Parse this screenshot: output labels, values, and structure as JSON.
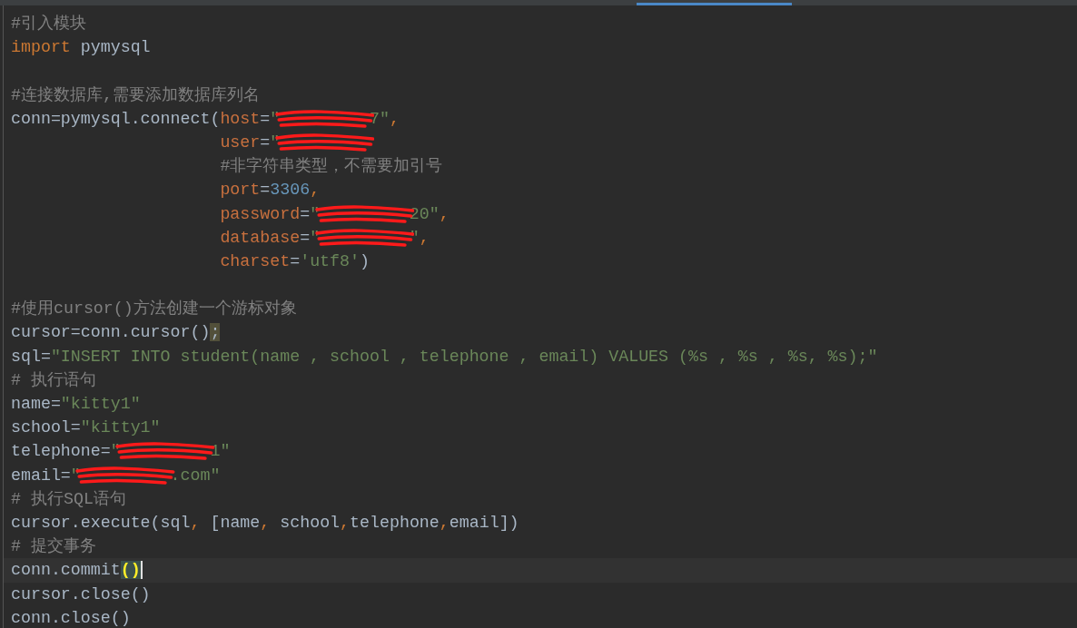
{
  "editor": {
    "lines": [
      {
        "tokens": [
          {
            "kind": "comment",
            "text": "#引入模块"
          }
        ]
      },
      {
        "tokens": [
          {
            "kind": "kw",
            "text": "import"
          },
          {
            "kind": "ident",
            "text": " pymysql"
          }
        ]
      },
      {
        "blank_before": true,
        "tokens": [
          {
            "kind": "comment",
            "text": "#连接数据库,需要添加数据库列名"
          }
        ]
      },
      {
        "tokens": [
          {
            "kind": "ident",
            "text": "conn=pymysql.connect("
          },
          {
            "kind": "param",
            "text": "host"
          },
          {
            "kind": "ident",
            "text": "="
          },
          {
            "kind": "str",
            "text": "\""
          },
          {
            "kind": "redacted"
          },
          {
            "kind": "str",
            "text": "7\""
          },
          {
            "kind": "kw",
            "text": ","
          }
        ]
      },
      {
        "indent": true,
        "tokens": [
          {
            "kind": "param",
            "text": "user"
          },
          {
            "kind": "ident",
            "text": "="
          },
          {
            "kind": "str",
            "text": "\""
          },
          {
            "kind": "redacted"
          }
        ]
      },
      {
        "indent": true,
        "tokens": [
          {
            "kind": "comment",
            "text": "#非字符串类型，不需要加引号"
          }
        ]
      },
      {
        "indent": true,
        "tokens": [
          {
            "kind": "param",
            "text": "port"
          },
          {
            "kind": "ident",
            "text": "="
          },
          {
            "kind": "num",
            "text": "3306"
          },
          {
            "kind": "kw",
            "text": ","
          }
        ]
      },
      {
        "indent": true,
        "tokens": [
          {
            "kind": "param",
            "text": "password"
          },
          {
            "kind": "ident",
            "text": "="
          },
          {
            "kind": "str",
            "text": "\""
          },
          {
            "kind": "redacted"
          },
          {
            "kind": "str",
            "text": "20\""
          },
          {
            "kind": "kw",
            "text": ","
          }
        ]
      },
      {
        "indent": true,
        "tokens": [
          {
            "kind": "param",
            "text": "database"
          },
          {
            "kind": "ident",
            "text": "="
          },
          {
            "kind": "str",
            "text": "\""
          },
          {
            "kind": "redacted"
          },
          {
            "kind": "str",
            "text": "\""
          },
          {
            "kind": "kw",
            "text": ","
          }
        ]
      },
      {
        "indent": true,
        "tokens": [
          {
            "kind": "param",
            "text": "charset"
          },
          {
            "kind": "ident",
            "text": "="
          },
          {
            "kind": "str",
            "text": "'utf8'"
          },
          {
            "kind": "ident",
            "text": ")"
          }
        ]
      },
      {
        "blank_before": true,
        "tokens": [
          {
            "kind": "comment",
            "text": "#使用cursor()方法创建一个游标对象"
          }
        ]
      },
      {
        "tokens": [
          {
            "kind": "ident",
            "text": "cursor=conn.cursor()"
          },
          {
            "kind": "warn",
            "text": ";"
          }
        ]
      },
      {
        "tokens": [
          {
            "kind": "ident",
            "text": "sql="
          },
          {
            "kind": "str",
            "text": "\"INSERT INTO student(name , school , telephone , email) VALUES (%s , %s , %s, %s);\""
          }
        ]
      },
      {
        "tokens": [
          {
            "kind": "comment",
            "text": "# 执行语句"
          }
        ]
      },
      {
        "tokens": [
          {
            "kind": "ident",
            "text": "name="
          },
          {
            "kind": "str",
            "text": "\"kitty1\""
          }
        ]
      },
      {
        "tokens": [
          {
            "kind": "ident",
            "text": "school="
          },
          {
            "kind": "str",
            "text": "\"kitty1\""
          }
        ]
      },
      {
        "tokens": [
          {
            "kind": "ident",
            "text": "telephone="
          },
          {
            "kind": "str",
            "text": "\""
          },
          {
            "kind": "redacted"
          },
          {
            "kind": "str",
            "text": "1\""
          }
        ]
      },
      {
        "tokens": [
          {
            "kind": "ident",
            "text": "email="
          },
          {
            "kind": "str",
            "text": "\""
          },
          {
            "kind": "redacted"
          },
          {
            "kind": "str",
            "text": ".com\""
          }
        ]
      },
      {
        "tokens": [
          {
            "kind": "comment",
            "text": "# 执行SQL语句"
          }
        ]
      },
      {
        "tokens": [
          {
            "kind": "ident",
            "text": "cursor.execute(sql"
          },
          {
            "kind": "kw",
            "text": ","
          },
          {
            "kind": "ident",
            "text": " [name"
          },
          {
            "kind": "kw",
            "text": ","
          },
          {
            "kind": "ident",
            "text": " school"
          },
          {
            "kind": "kw",
            "text": ","
          },
          {
            "kind": "ident",
            "text": "telephone"
          },
          {
            "kind": "kw",
            "text": ","
          },
          {
            "kind": "ident",
            "text": "email])"
          }
        ]
      },
      {
        "tokens": [
          {
            "kind": "comment",
            "text": "# 提交事务"
          }
        ]
      },
      {
        "current": true,
        "tokens": [
          {
            "kind": "ident",
            "text": "conn.commit"
          },
          {
            "kind": "match",
            "text": "()"
          }
        ]
      },
      {
        "tokens": [
          {
            "kind": "ident",
            "text": "cursor.close()"
          }
        ]
      },
      {
        "tokens": [
          {
            "kind": "ident",
            "text": "conn.close()"
          }
        ]
      }
    ]
  }
}
